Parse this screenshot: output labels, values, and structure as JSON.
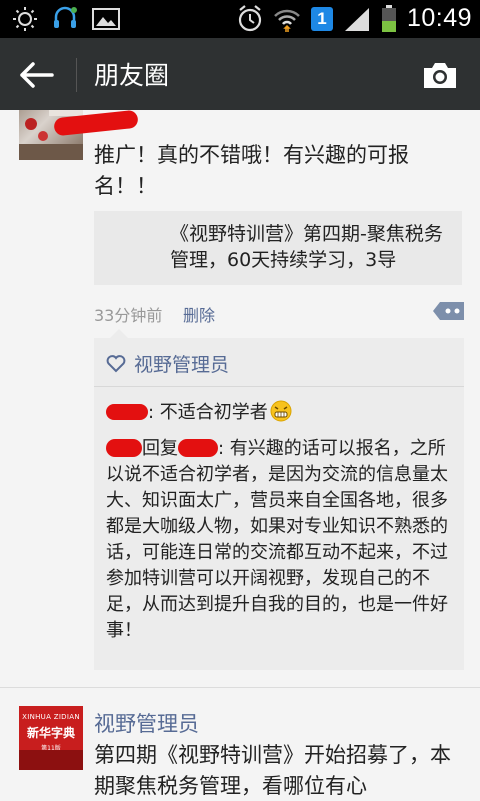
{
  "status_bar": {
    "time": "10:49",
    "notification_badge": "1",
    "icons": [
      "brightness-icon",
      "headset-icon",
      "image-icon",
      "alarm-icon",
      "wifi-icon",
      "sim-badge-icon",
      "signal-icon",
      "battery-icon"
    ]
  },
  "titlebar": {
    "title": "朋友圈",
    "back_icon": "arrow-left-icon",
    "camera_icon": "camera-icon",
    "background": "#2e3132"
  },
  "post1": {
    "text": "推广！真的不错哦！有兴趣的可报名！！",
    "link_card_title": "《视野特训营》第四期-聚焦税务管理，60天持续学习，3导",
    "time": "33分钟前",
    "delete_label": "删除",
    "likes": "视野管理员",
    "comments": [
      {
        "sep": ": ",
        "text": "不适合初学者"
      },
      {
        "reply_word": "回复",
        "sep": ": ",
        "text": "有兴趣的话可以报名，之所以说不适合初学者，是因为交流的信息量太大、知识面太广，营员来自全国各地，很多都是大咖级人物，如果对专业知识不熟悉的话，可能连日常的交流都互动不起来，不过参加特训营可以开阔视野，发现自己的不足，从而达到提升自我的目的，也是一件好事！"
      }
    ]
  },
  "post2": {
    "author": "视野管理员",
    "text": "第四期《视野特训营》开始招募了，本期聚焦税务管理，看哪位有心",
    "avatar_pinyin": "XINHUA ZIDIAN",
    "avatar_title": "新华字典",
    "avatar_subtitle": "第11版"
  },
  "colors": {
    "link_blue": "#576b95",
    "redaction_red": "#e31010",
    "feed_bg": "#f4f4f4"
  }
}
